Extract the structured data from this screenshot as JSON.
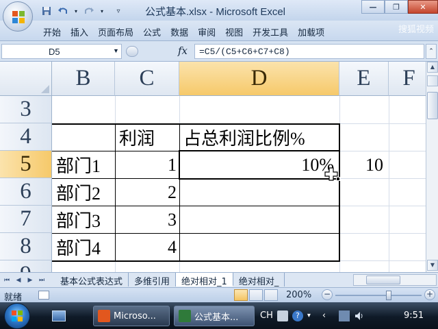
{
  "window": {
    "title": "公式基本.xlsx - Microsoft Excel",
    "controls": {
      "minimize": "—",
      "restore": "❐",
      "close": "✕"
    }
  },
  "ribbon": {
    "tabs": [
      "开始",
      "插入",
      "页面布局",
      "公式",
      "数据",
      "审阅",
      "视图",
      "开发工具",
      "加载项"
    ],
    "watermark": "搜狐视频"
  },
  "formula_bar": {
    "name_box": "D5",
    "fx": "fx",
    "formula": "=C5/(C5+C6+C7+C8)"
  },
  "grid": {
    "columns": [
      "B",
      "C",
      "D",
      "E",
      "F"
    ],
    "selected_column": "D",
    "rows": [
      "3",
      "4",
      "5",
      "6",
      "7",
      "8",
      "9"
    ],
    "selected_row": "5",
    "cells": {
      "C4": "利润",
      "D4": "占总利润比例%",
      "B5": "部门1",
      "C5": "1",
      "D5": "10%",
      "E5": "10",
      "B6": "部门2",
      "C6": "2",
      "B7": "部门3",
      "C7": "3",
      "B8": "部门4",
      "C8": "4"
    }
  },
  "sheet_tabs": {
    "nav": [
      "⏮",
      "◀",
      "▶",
      "⏭"
    ],
    "tabs": [
      "基本公式表达式",
      "多维引用",
      "绝对相对_1",
      "绝对相对_"
    ],
    "active": "绝对相对_1"
  },
  "status_bar": {
    "mode": "就绪",
    "zoom": "200%",
    "zoom_out": "−",
    "zoom_in": "+"
  },
  "taskbar": {
    "tasks": [
      {
        "label": "Microso...",
        "icon": "office-icon"
      },
      {
        "label": "公式基本...",
        "icon": "excel-icon"
      }
    ],
    "input_lang": "CH",
    "clock": "9:51"
  },
  "colors": {
    "selected_header": "#f6c96a",
    "title_bar": "#c3d5ec",
    "close_button": "#c4452c",
    "taskbar": "#0f1a27"
  }
}
